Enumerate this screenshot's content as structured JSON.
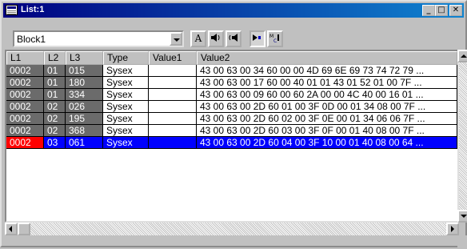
{
  "window": {
    "title": "List:1",
    "minimize": "_",
    "maximize": "□",
    "close": "✕"
  },
  "toolbar": {
    "block_select": "Block1",
    "font_button": "A",
    "tools": [
      "speaker-left-icon",
      "speaker-right-icon",
      "play-mark-icon",
      "midi-icon"
    ]
  },
  "table": {
    "columns": [
      "L1",
      "L2",
      "L3",
      "Type",
      "Value1",
      "Value2"
    ],
    "rows": [
      {
        "l1": "0002",
        "l2": "01",
        "l3": "015",
        "type": "Sysex",
        "value1": "",
        "value2": "43 00 63 00 34 60 00 00 4D 69 6E 69 73 74 72 79 ..."
      },
      {
        "l1": "0002",
        "l2": "01",
        "l3": "180",
        "type": "Sysex",
        "value1": "",
        "value2": "43 00 63 00 17 60 00 40 01 01 43 01 52 01 00 7F ..."
      },
      {
        "l1": "0002",
        "l2": "01",
        "l3": "334",
        "type": "Sysex",
        "value1": "",
        "value2": "43 00 63 00 09 60 00 60 2A 00 00 4C 40 00 16 01 ..."
      },
      {
        "l1": "0002",
        "l2": "02",
        "l3": "026",
        "type": "Sysex",
        "value1": "",
        "value2": "43 00 63 00 2D 60 01 00 3F 0D 00 01 34 08 00 7F ..."
      },
      {
        "l1": "0002",
        "l2": "02",
        "l3": "195",
        "type": "Sysex",
        "value1": "",
        "value2": "43 00 63 00 2D 60 02 00 3F 0E 00 01 34 06 06 7F ..."
      },
      {
        "l1": "0002",
        "l2": "02",
        "l3": "368",
        "type": "Sysex",
        "value1": "",
        "value2": "43 00 63 00 2D 60 03 00 3F 0F 00 01 40 08 00 7F ..."
      },
      {
        "l1": "0002",
        "l2": "03",
        "l3": "061",
        "type": "Sysex",
        "value1": "",
        "value2": "43 00 63 00 2D 60 04 00 3F 10 00 01 40 08 00 64 ..."
      }
    ],
    "selected_row_index": 6
  },
  "colors": {
    "titlebar": "#000080",
    "selection": "#0000ff",
    "cursor_cell": "#ff0000",
    "dark_cell": "#6b6b6b"
  }
}
